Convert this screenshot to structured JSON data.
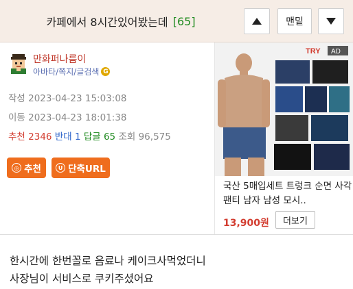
{
  "header": {
    "title": "카페에서 8시간있어봤는데",
    "comment_count": "[65]",
    "up_button": "up",
    "middle_button": "맨밑",
    "down_button": "down"
  },
  "author": {
    "name": "만화퍼나름이",
    "links": "아바타/쪽지/글검색"
  },
  "meta": {
    "created": "작성 2023-04-23 15:03:08",
    "moved": "이동 2023-04-23 18:01:38"
  },
  "stats": {
    "recommend_label": "추천",
    "recommend": "2346",
    "oppose_label": "반대",
    "oppose": "1",
    "reply_label": "답글",
    "reply": "65",
    "view_label": "조회",
    "view": "96,575"
  },
  "actions": {
    "recommend_button": "추천",
    "short_url_button": "단축URL"
  },
  "ad": {
    "title": "국산 5매입세트 트렁크 순면 사각 팬티 남자 남성 모시..",
    "price": "13,900원",
    "more_button": "더보기",
    "brand_badge": "TRY",
    "ad_badge": "AD"
  },
  "content": {
    "line1": "한시간에 한번꼴로 음료나 케이크사먹었더니",
    "line2": "사장님이 서비스로 쿠키주셨어요"
  },
  "colors": {
    "header_bg": "#f6ede6",
    "accent_orange": "#ef6d1d",
    "recommend_red": "#d23b2e",
    "oppose_blue": "#2a62c9",
    "reply_green": "#1f8a1f"
  }
}
